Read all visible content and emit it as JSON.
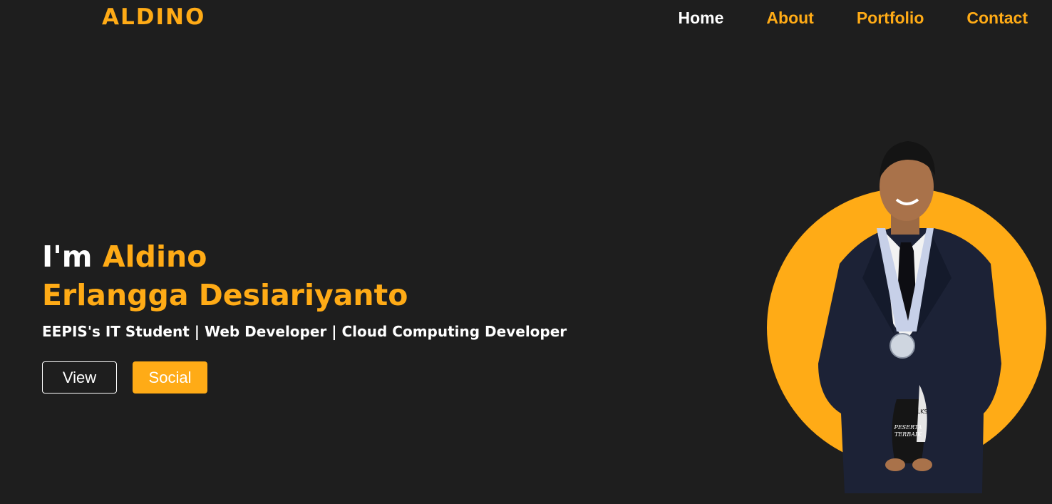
{
  "header": {
    "logo": "ALDINO",
    "nav": [
      {
        "label": "Home",
        "active": true
      },
      {
        "label": "About",
        "active": false
      },
      {
        "label": "Portfolio",
        "active": false
      },
      {
        "label": "Contact",
        "active": false
      }
    ]
  },
  "hero": {
    "greeting": "I'm ",
    "first_name": "Aldino",
    "last_name": "Erlangga Desiariyanto",
    "subtitle": "EEPIS's IT Student | Web Developer | Cloud Computing Developer",
    "view_label": "View",
    "social_label": "Social"
  },
  "portrait": {
    "trophy_line1": "PESERTA",
    "trophy_line2": "TERBAIK",
    "trophy_banner": "LKS"
  },
  "colors": {
    "accent": "#ffab16",
    "background": "#1e1e1e",
    "text": "#ffffff"
  }
}
